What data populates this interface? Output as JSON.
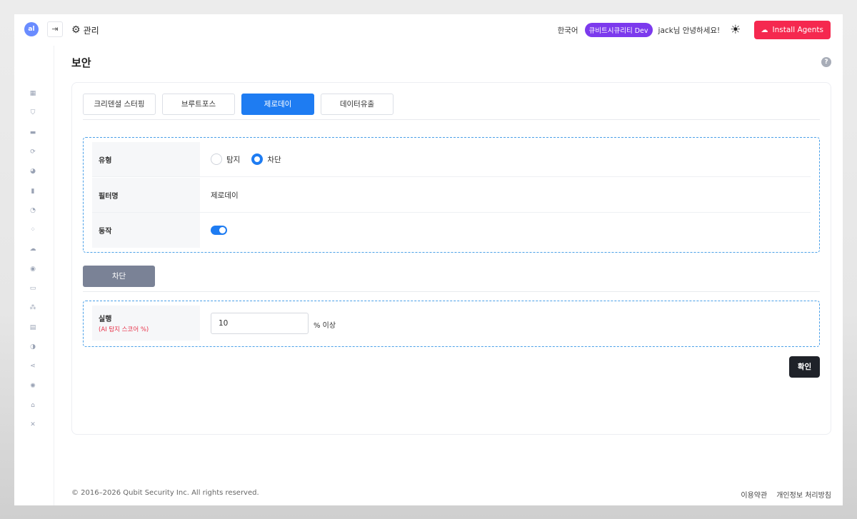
{
  "header": {
    "logo_text": "al",
    "collapse_icon": "arrow-right-icon",
    "section_label": "관리",
    "language": "한국어",
    "env_badge": "큐비트시큐리티 Dev",
    "greeting": "jack님 안녕하세요!",
    "install_label": "Install Agents",
    "install_color": "#f5284f"
  },
  "sidebar": {
    "items": [
      {
        "icon": "dashboard-icon",
        "glyph": "▦"
      },
      {
        "icon": "shield-icon",
        "glyph": "⛉"
      },
      {
        "icon": "monitor-icon",
        "glyph": "▬"
      },
      {
        "icon": "refresh-icon",
        "glyph": "⟳"
      },
      {
        "icon": "globe-icon",
        "glyph": "◕"
      },
      {
        "icon": "server-icon",
        "glyph": "▮"
      },
      {
        "icon": "loader-icon",
        "glyph": "◔"
      },
      {
        "icon": "apps-icon",
        "glyph": "⁘"
      },
      {
        "icon": "cloud-download-icon",
        "glyph": "☁"
      },
      {
        "icon": "target-icon",
        "glyph": "◉"
      },
      {
        "icon": "toggle-icon",
        "glyph": "▭"
      },
      {
        "icon": "network-icon",
        "glyph": "⁂"
      },
      {
        "icon": "calendar-icon",
        "glyph": "▤"
      },
      {
        "icon": "chart-pie-icon",
        "glyph": "◑"
      },
      {
        "icon": "share-icon",
        "glyph": "⋖"
      },
      {
        "icon": "sun-small-icon",
        "glyph": "✺"
      },
      {
        "icon": "education-icon",
        "glyph": "⌂"
      },
      {
        "icon": "close-icon",
        "glyph": "✕"
      }
    ]
  },
  "page": {
    "title": "보안",
    "help": "?"
  },
  "tabs": [
    {
      "label": "크리덴셜 스터핑",
      "active": false
    },
    {
      "label": "브루트포스",
      "active": false
    },
    {
      "label": "제로데이",
      "active": true
    },
    {
      "label": "데이터유출",
      "active": false
    }
  ],
  "form": {
    "type_label": "유형",
    "type_options": [
      {
        "label": "탐지",
        "checked": false
      },
      {
        "label": "차단",
        "checked": true
      }
    ],
    "filter_label": "필터명",
    "filter_value": "제로데이",
    "action_label": "동작",
    "action_enabled": true
  },
  "block_button": "차단",
  "execute": {
    "label": "실행",
    "sublabel": "(AI 탐지 스코어 %)",
    "value": "10",
    "unit": "% 이상"
  },
  "confirm_button": "확인",
  "footer": {
    "copyright": "© 2016–2026 Qubit Security Inc. All rights reserved.",
    "terms": "이용약관",
    "privacy": "개인정보 처리방침"
  }
}
